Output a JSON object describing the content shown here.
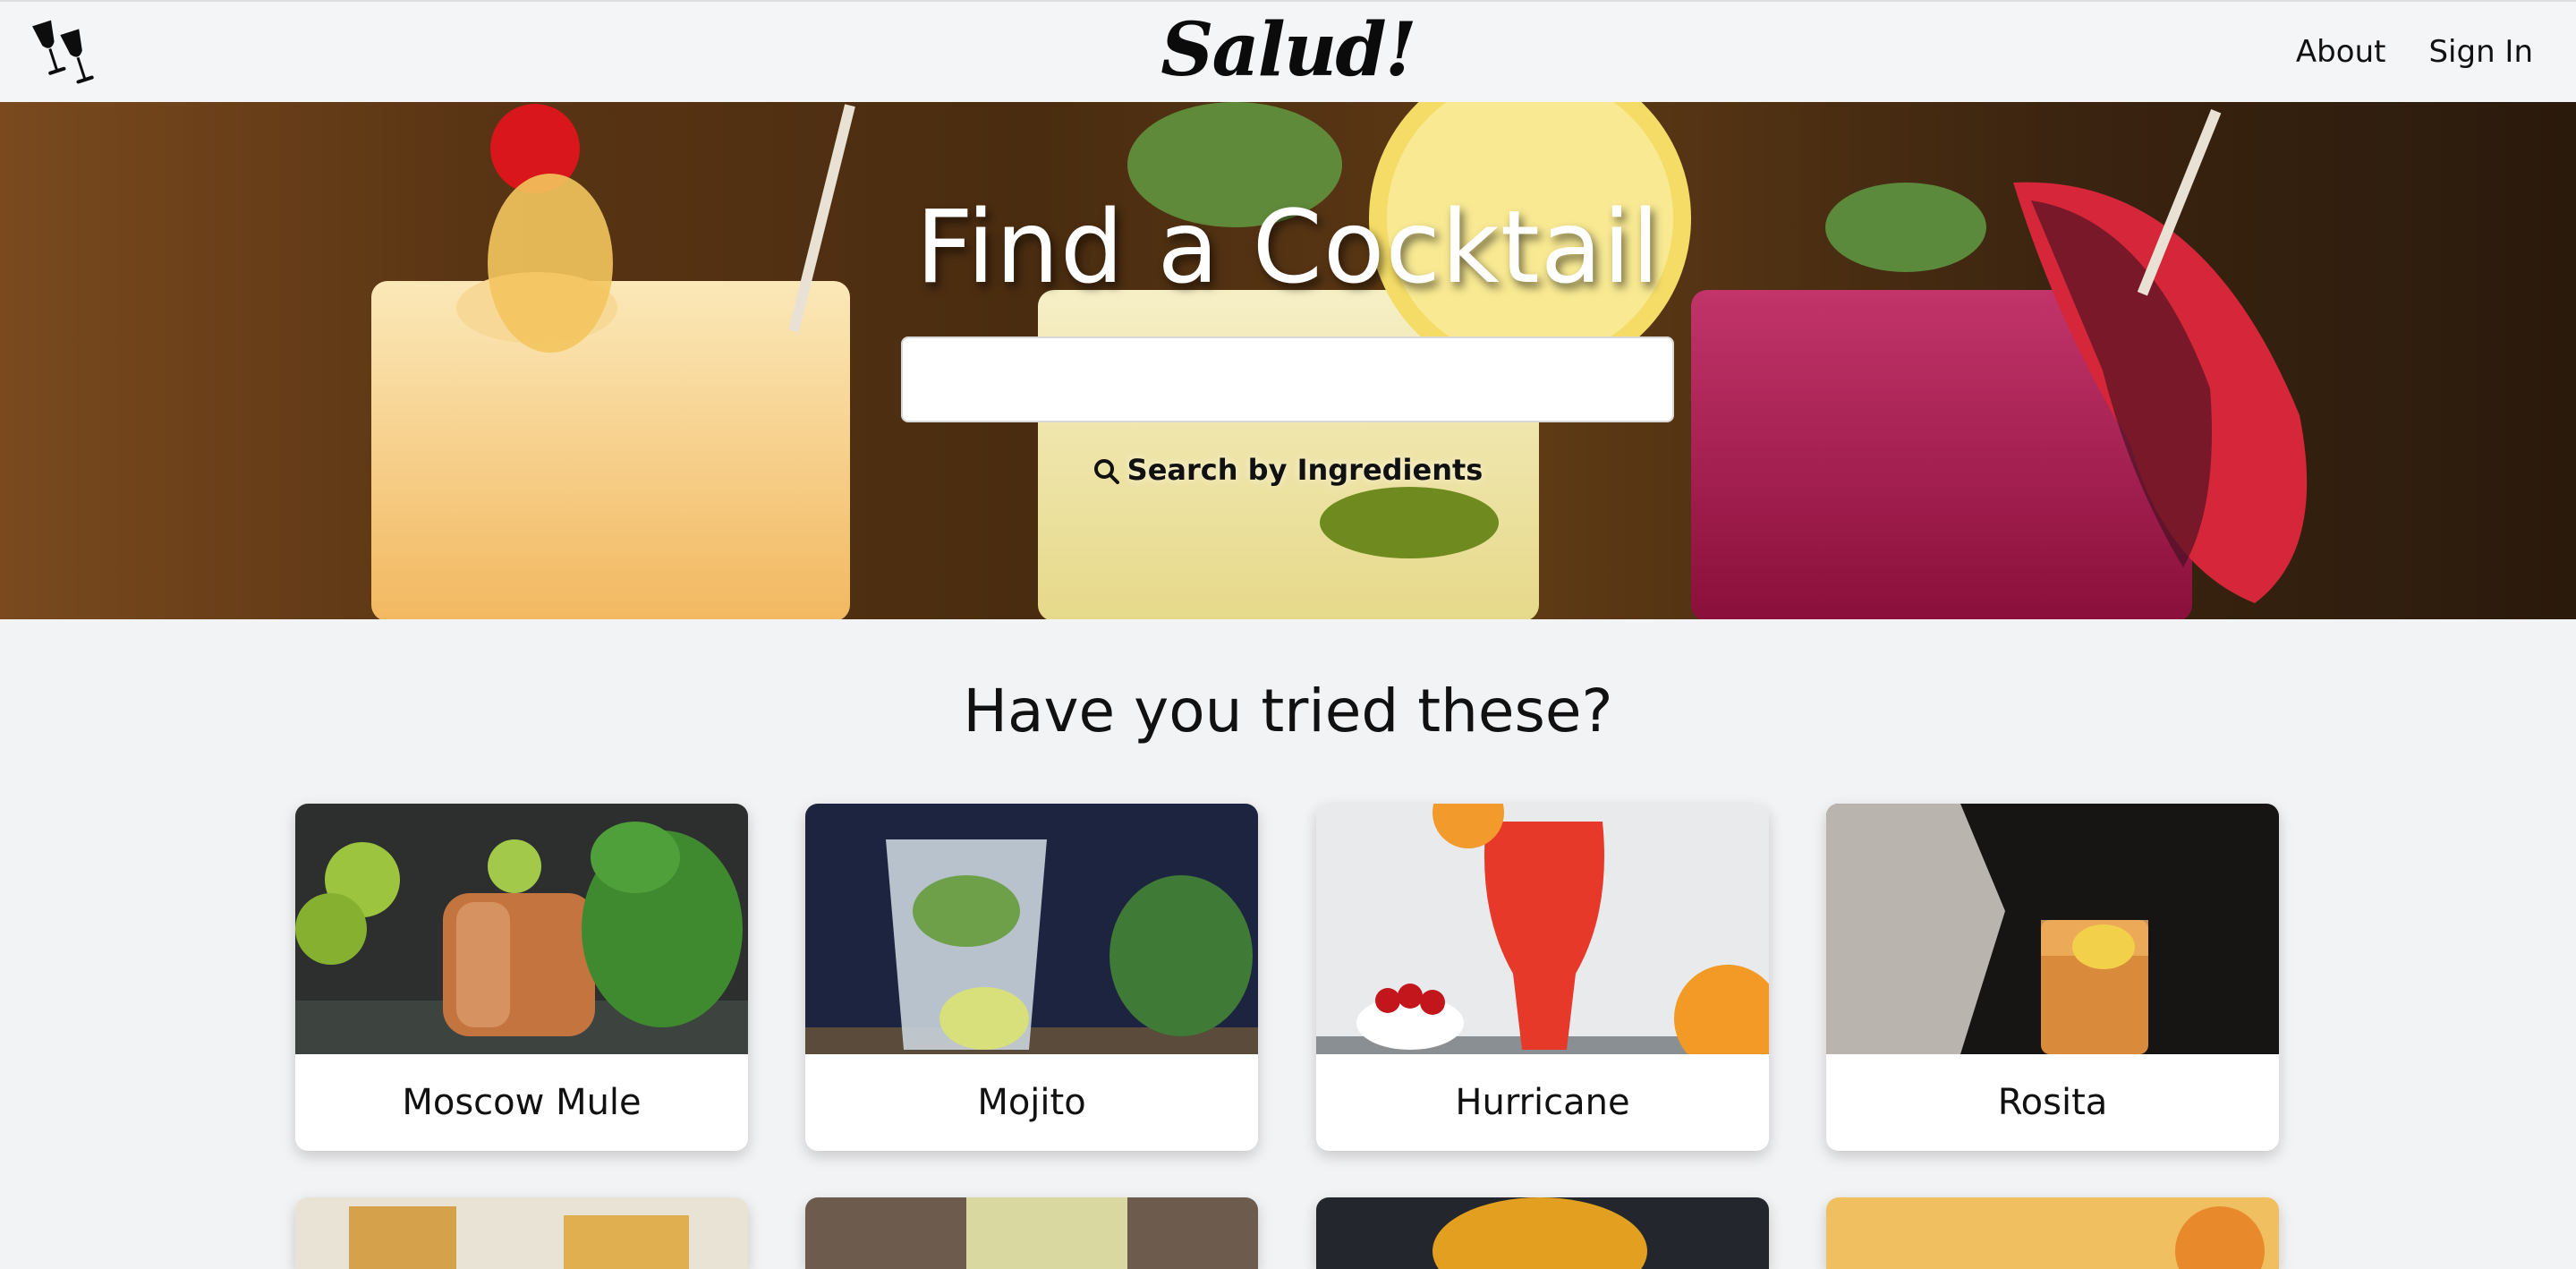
{
  "navbar": {
    "brand": "Salud!",
    "logo_icon": "wine-glasses-cheers-icon",
    "links": [
      {
        "label": "About"
      },
      {
        "label": "Sign In"
      }
    ]
  },
  "hero": {
    "title": "Find a Cocktail",
    "search": {
      "placeholder": "",
      "value": ""
    },
    "ingredients_link": "Search by Ingredients",
    "ingredients_icon": "search-icon"
  },
  "section": {
    "title": "Have you tried these?"
  },
  "cards": [
    {
      "name": "Moscow Mule"
    },
    {
      "name": "Mojito"
    },
    {
      "name": "Hurricane"
    },
    {
      "name": "Rosita"
    }
  ],
  "colors": {
    "background": "#f2f3f5",
    "navbar": "#f4f5f7",
    "text": "#111111",
    "card": "#ffffff"
  }
}
